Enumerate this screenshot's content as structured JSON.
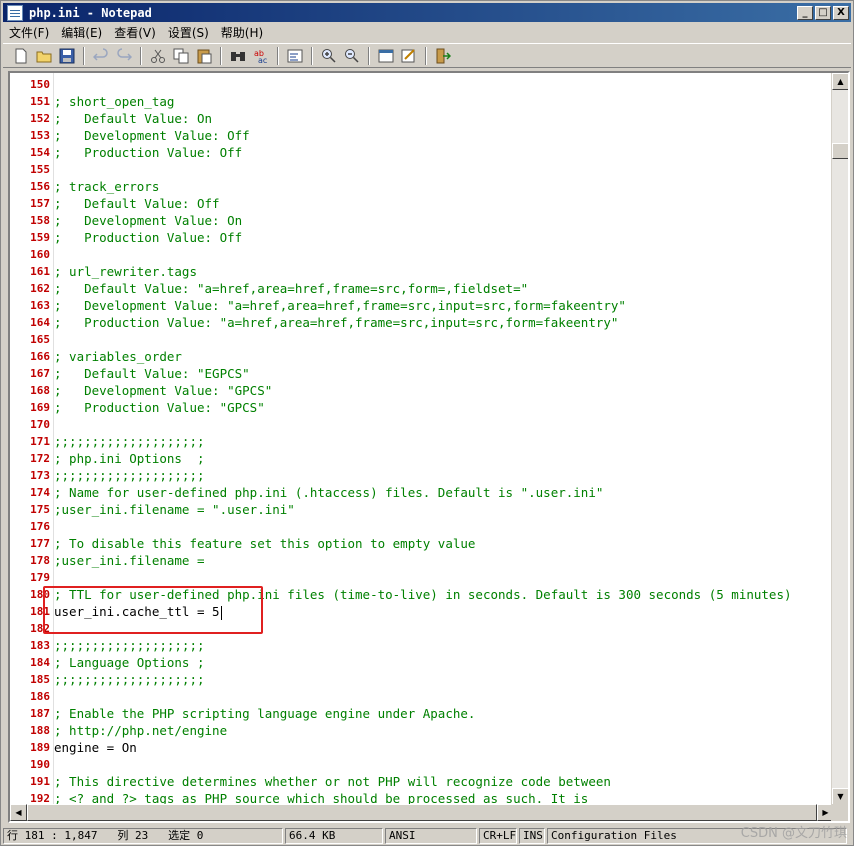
{
  "window": {
    "title": "php.ini - Notepad",
    "minimize": "_",
    "maximize": "□",
    "close": "X"
  },
  "menu": [
    "文件(F)",
    "编辑(E)",
    "查看(V)",
    "设置(S)",
    "帮助(H)"
  ],
  "toolbar": [
    "new-file-icon",
    "open-folder-icon",
    "save-icon",
    "undo-icon",
    "redo-icon",
    "cut-icon",
    "copy-icon",
    "paste-icon",
    "find-icon",
    "replace-icon",
    "wrap-icon",
    "zoom-in-icon",
    "zoom-out-icon",
    "view-icon",
    "settings-icon",
    "exit-icon"
  ],
  "editor": {
    "lines": [
      {
        "n": "150",
        "t": ""
      },
      {
        "n": "151",
        "t": "; short_open_tag"
      },
      {
        "n": "152",
        "t": ";   Default Value: On"
      },
      {
        "n": "153",
        "t": ";   Development Value: Off"
      },
      {
        "n": "154",
        "t": ";   Production Value: Off"
      },
      {
        "n": "155",
        "t": ""
      },
      {
        "n": "156",
        "t": "; track_errors"
      },
      {
        "n": "157",
        "t": ";   Default Value: Off"
      },
      {
        "n": "158",
        "t": ";   Development Value: On"
      },
      {
        "n": "159",
        "t": ";   Production Value: Off"
      },
      {
        "n": "160",
        "t": ""
      },
      {
        "n": "161",
        "t": "; url_rewriter.tags"
      },
      {
        "n": "162",
        "t": ";   Default Value: \"a=href,area=href,frame=src,form=,fieldset=\""
      },
      {
        "n": "163",
        "t": ";   Development Value: \"a=href,area=href,frame=src,input=src,form=fakeentry\""
      },
      {
        "n": "164",
        "t": ";   Production Value: \"a=href,area=href,frame=src,input=src,form=fakeentry\""
      },
      {
        "n": "165",
        "t": ""
      },
      {
        "n": "166",
        "t": "; variables_order"
      },
      {
        "n": "167",
        "t": ";   Default Value: \"EGPCS\""
      },
      {
        "n": "168",
        "t": ";   Development Value: \"GPCS\""
      },
      {
        "n": "169",
        "t": ";   Production Value: \"GPCS\""
      },
      {
        "n": "170",
        "t": ""
      },
      {
        "n": "171",
        "t": ";;;;;;;;;;;;;;;;;;;;"
      },
      {
        "n": "172",
        "t": "; php.ini Options  ;"
      },
      {
        "n": "173",
        "t": ";;;;;;;;;;;;;;;;;;;;"
      },
      {
        "n": "174",
        "t": "; Name for user-defined php.ini (.htaccess) files. Default is \".user.ini\""
      },
      {
        "n": "175",
        "t": ";user_ini.filename = \".user.ini\""
      },
      {
        "n": "176",
        "t": ""
      },
      {
        "n": "177",
        "t": "; To disable this feature set this option to empty value"
      },
      {
        "n": "178",
        "t": ";user_ini.filename ="
      },
      {
        "n": "179",
        "t": ""
      },
      {
        "n": "180",
        "t": "; TTL for user-defined php.ini files (time-to-live) in seconds. Default is 300 seconds (5 minutes)"
      },
      {
        "n": "181",
        "t": "user_ini.cache_ttl = 5"
      },
      {
        "n": "182",
        "t": ""
      },
      {
        "n": "183",
        "t": ";;;;;;;;;;;;;;;;;;;;"
      },
      {
        "n": "184",
        "t": "; Language Options ;"
      },
      {
        "n": "185",
        "t": ";;;;;;;;;;;;;;;;;;;;"
      },
      {
        "n": "186",
        "t": ""
      },
      {
        "n": "187",
        "t": "; Enable the PHP scripting language engine under Apache."
      },
      {
        "n": "188",
        "t": "; http://php.net/engine"
      },
      {
        "n": "189",
        "t": "engine = On"
      },
      {
        "n": "190",
        "t": ""
      },
      {
        "n": "191",
        "t": "; This directive determines whether or not PHP will recognize code between"
      },
      {
        "n": "192",
        "t": "; <? and ?> tags as PHP source which should be processed as such. It is"
      }
    ]
  },
  "status": {
    "position": "行 181 : 1,847   列 23   选定 0",
    "size": "66.4 KB",
    "encoding": "ANSI",
    "eol": "CR+LF",
    "mode": "INS",
    "filetype": "Configuration Files"
  },
  "watermark": "CSDN @文刀竹琪"
}
